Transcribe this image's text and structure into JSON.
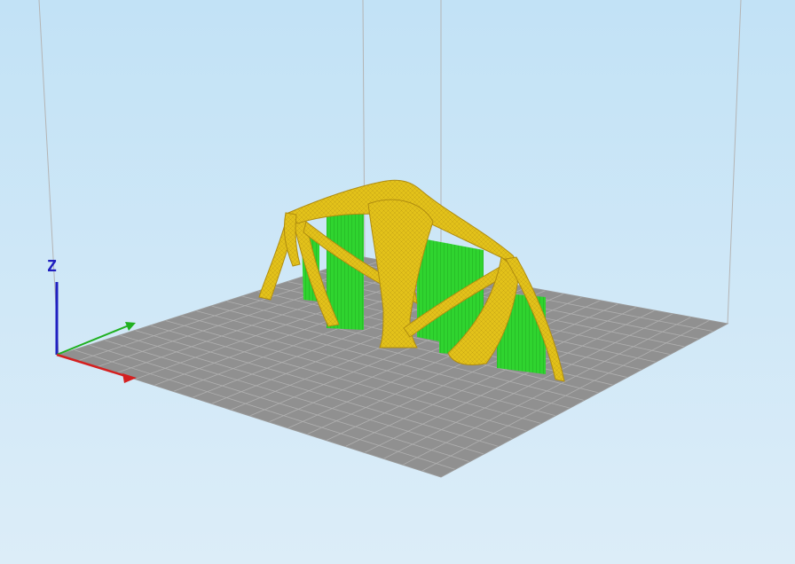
{
  "view": {
    "background_top": "#c2e2f6",
    "background_bottom": "#dcedf8"
  },
  "build_plate": {
    "color": "#909090",
    "grid_line_color": "#b0b0b0",
    "grid_divisions": 20,
    "vertical_edge_color": "#b4b4b4"
  },
  "axes": {
    "z_label": "Z",
    "x_label": "",
    "x_color": "#d42020",
    "y_color": "#20b020",
    "z_color": "#2020c0"
  },
  "model": {
    "name": "",
    "body_color": "#e3c21a",
    "body_shade": "#c79f12",
    "support_color": "#2fd42f",
    "support_shade": "#1a9a1a"
  }
}
